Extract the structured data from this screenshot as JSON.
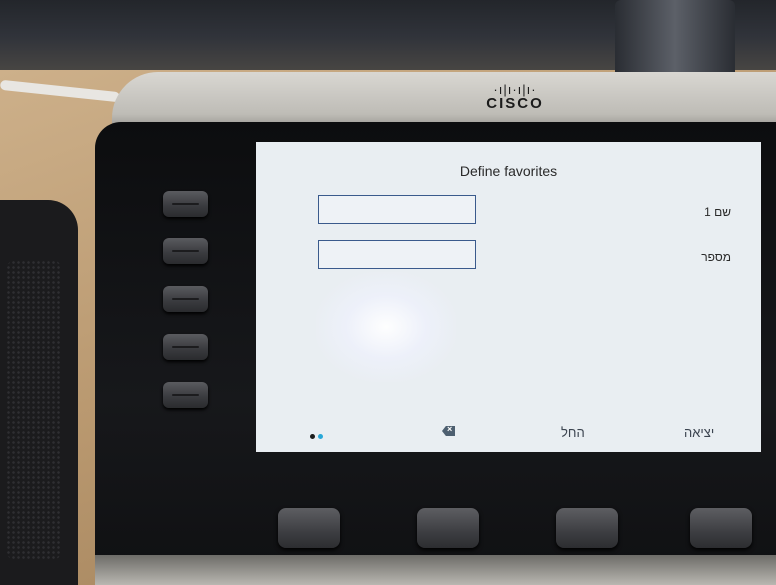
{
  "brand": {
    "logo_text": "CISCO",
    "logo_bars": "·ı|ı·ı|ı·"
  },
  "screen": {
    "title": "Define favorites",
    "fields": [
      {
        "label": "שם 1",
        "value": "",
        "placeholder": ""
      },
      {
        "label": "מספר",
        "value": "",
        "placeholder": ""
      }
    ],
    "page_dots": {
      "active": "#1c1c1c",
      "inactive": "#29a8d8"
    },
    "softkeys": [
      {
        "name": "exit",
        "label": "יציאה",
        "icon": ""
      },
      {
        "name": "replace",
        "label": "החל",
        "icon": ""
      },
      {
        "name": "backspace",
        "label": "",
        "icon": "backspace-icon"
      }
    ]
  },
  "colors": {
    "screen_bg": "#e9eef2",
    "field_border": "#3a5a8c",
    "bezel": "#121315"
  }
}
